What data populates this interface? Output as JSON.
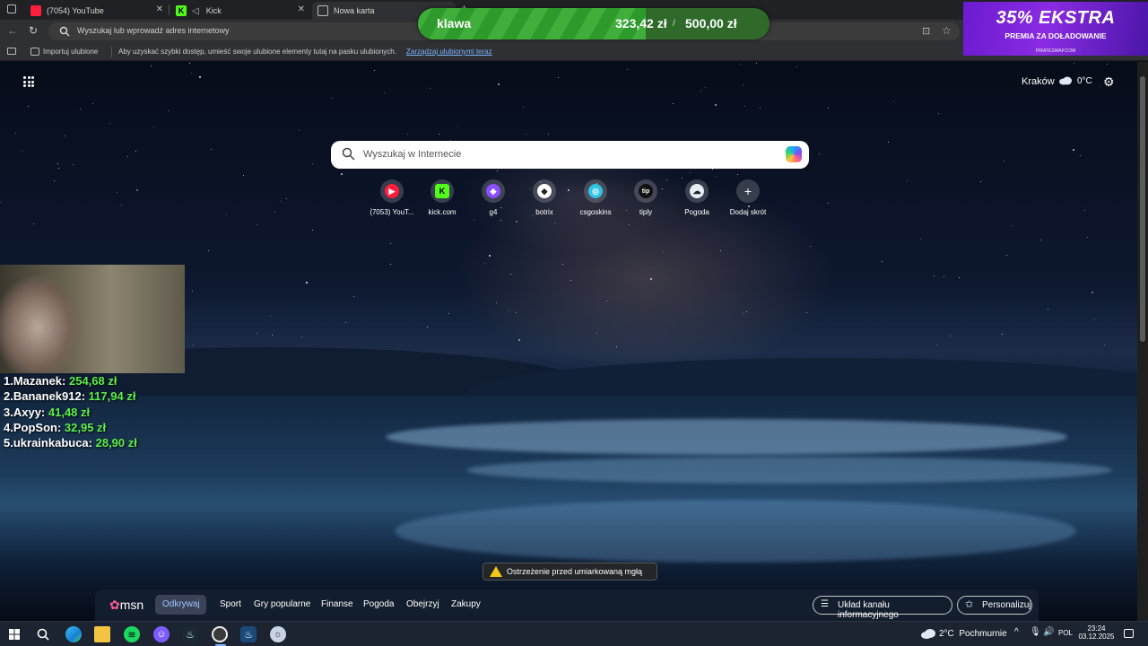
{
  "tabs": [
    {
      "title": "(7054) YouTube",
      "favicon_color": "#ff1e3c"
    },
    {
      "title": "Kick",
      "favicon_color": "#53fc18"
    },
    {
      "title": "Nowa karta",
      "favicon_color": "#9aa0a6"
    }
  ],
  "address_bar": {
    "placeholder": "Wyszukaj lub wprowadź adres internetowy"
  },
  "favorites_bar": {
    "import_label": "Importuj ulubione",
    "hint": "Aby uzyskać szybki dostęp, umieść swoje ulubione elementy tutaj na pasku ulubionych.",
    "manage_link": "Zarządzaj ulubionymi teraz"
  },
  "goal": {
    "name": "klawa",
    "current": "323,42 zł",
    "target": "500,00 zł",
    "progress": 0.6468
  },
  "promo": {
    "title": "35% EKSTRA",
    "subtitle": "PREMIA ZA DOŁADOWANIE",
    "brand": "PIRATESWAP.COM"
  },
  "weather": {
    "city": "Kraków",
    "temp": "0°C"
  },
  "search": {
    "placeholder": "Wyszukaj w Internecie"
  },
  "shortcuts": [
    {
      "label": "(7053) YouT...",
      "icon": "youtube-icon",
      "color": "#ff1e3c",
      "glyph": "▶"
    },
    {
      "label": "kick.com",
      "icon": "kick-icon",
      "color": "#53fc18",
      "glyph": "K"
    },
    {
      "label": "g4",
      "icon": "g4-icon",
      "color": "#8a4fff",
      "glyph": "◆"
    },
    {
      "label": "botrix",
      "icon": "botrix-icon",
      "color": "#ffffff",
      "glyph": "◆"
    },
    {
      "label": "csgoskins",
      "icon": "csgoskins-icon",
      "color": "#2ec4e6",
      "glyph": "◎"
    },
    {
      "label": "tiply",
      "icon": "tiply-icon",
      "color": "#111111",
      "glyph": "tip"
    },
    {
      "label": "Pogoda",
      "icon": "weather-icon",
      "color": "#e8eef6",
      "glyph": "☁"
    },
    {
      "label": "Dodaj skrót",
      "icon": "plus-icon",
      "color": "#ffffff",
      "glyph": "+"
    }
  ],
  "leaderboard": [
    {
      "rank": "1.",
      "name": "Mazanek:",
      "amount": "254,68 zł"
    },
    {
      "rank": "2.",
      "name": "Bananek912:",
      "amount": "117,94 zł"
    },
    {
      "rank": "3.",
      "name": "Axyy:",
      "amount": "41,48 zł"
    },
    {
      "rank": "4.",
      "name": "PopSon:",
      "amount": "32,95 zł"
    },
    {
      "rank": "5.",
      "name": "ukrainkabuca:",
      "amount": "28,90 zł"
    }
  ],
  "alert": {
    "text": "Ostrzeżenie przed umiarkowaną mgłą"
  },
  "msn": {
    "logo": "msn",
    "tabs": [
      "Odkrywaj",
      "Sport",
      "Gry popularne",
      "Finanse",
      "Pogoda",
      "Obejrzyj",
      "Zakupy"
    ],
    "layout_button": "Układ kanału informacyjnego",
    "personalize_button": "Personalizuj"
  },
  "taskbar": {
    "weather": "2°C  Pochmurnie",
    "lang": "POL",
    "time": "23:24",
    "date": "03.12.2025"
  }
}
